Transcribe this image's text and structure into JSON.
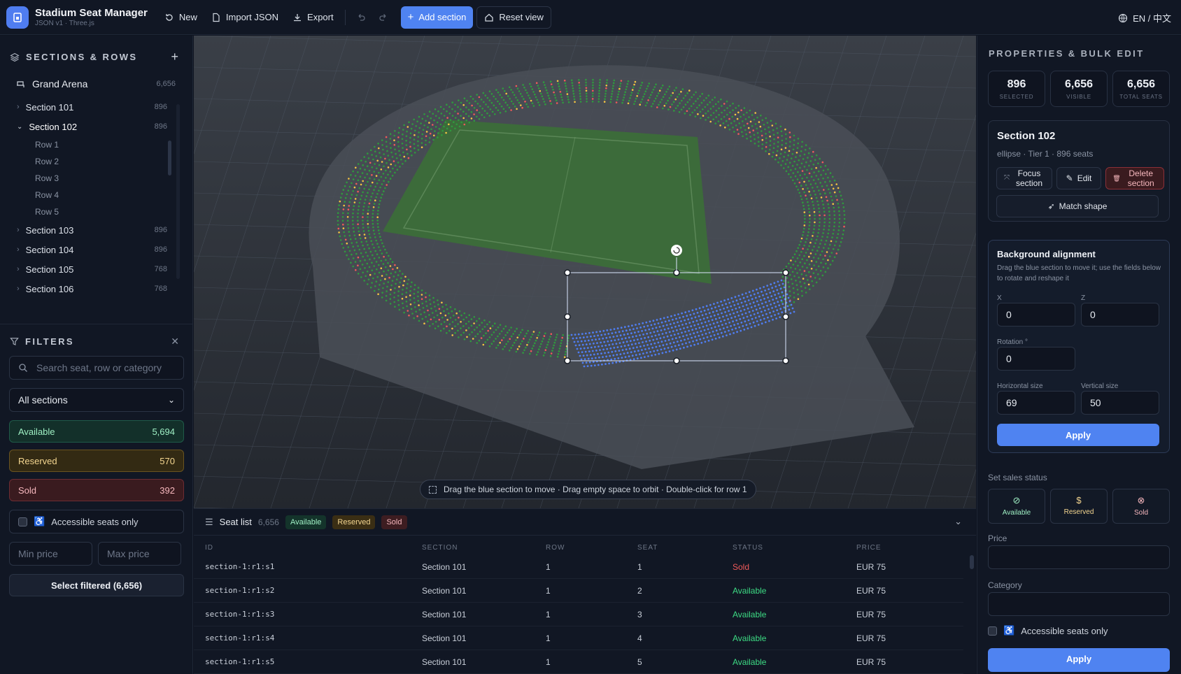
{
  "app": {
    "title": "Stadium Seat Manager",
    "subtitle": "JSON v1 · Three.js"
  },
  "toolbar": {
    "new": "New",
    "import": "Import JSON",
    "export": "Export",
    "add_section": "Add section",
    "reset_view": "Reset view",
    "lang": "EN / 中文"
  },
  "sections_panel": {
    "title": "SECTIONS & ROWS",
    "venue": {
      "name": "Grand Arena",
      "count": "6,656"
    },
    "sections": [
      {
        "name": "Section 101",
        "count": "896"
      },
      {
        "name": "Section 102",
        "count": "896"
      },
      {
        "name": "Section 103",
        "count": "896"
      },
      {
        "name": "Section 104",
        "count": "896"
      },
      {
        "name": "Section 105",
        "count": "768"
      },
      {
        "name": "Section 106",
        "count": "768"
      }
    ],
    "rows": [
      "Row 1",
      "Row 2",
      "Row 3",
      "Row 4",
      "Row 5"
    ]
  },
  "filters": {
    "title": "FILTERS",
    "search_placeholder": "Search seat, row or category",
    "section_select": "All sections",
    "available": {
      "label": "Available",
      "count": "5,694"
    },
    "reserved": {
      "label": "Reserved",
      "count": "570"
    },
    "sold": {
      "label": "Sold",
      "count": "392"
    },
    "accessible": "Accessible seats only",
    "min_price": "Min price",
    "max_price": "Max price",
    "select_filtered": "Select filtered (6,656)"
  },
  "viewport": {
    "hint": "Drag the blue section to move · Drag empty space to orbit · Double-click for row 1"
  },
  "seat_list": {
    "title": "Seat list",
    "count": "6,656",
    "badges": [
      "Available",
      "Reserved",
      "Sold"
    ],
    "columns": [
      "ID",
      "SECTION",
      "ROW",
      "SEAT",
      "STATUS",
      "PRICE"
    ],
    "rows": [
      {
        "id": "section-1:r1:s1",
        "section": "Section 101",
        "row": "1",
        "seat": "1",
        "status": "Sold",
        "price": "EUR 75"
      },
      {
        "id": "section-1:r1:s2",
        "section": "Section 101",
        "row": "1",
        "seat": "2",
        "status": "Available",
        "price": "EUR 75"
      },
      {
        "id": "section-1:r1:s3",
        "section": "Section 101",
        "row": "1",
        "seat": "3",
        "status": "Available",
        "price": "EUR 75"
      },
      {
        "id": "section-1:r1:s4",
        "section": "Section 101",
        "row": "1",
        "seat": "4",
        "status": "Available",
        "price": "EUR 75"
      },
      {
        "id": "section-1:r1:s5",
        "section": "Section 101",
        "row": "1",
        "seat": "5",
        "status": "Available",
        "price": "EUR 75"
      }
    ]
  },
  "properties": {
    "title": "PROPERTIES & BULK EDIT",
    "kpis": [
      {
        "value": "896",
        "label": "SELECTED"
      },
      {
        "value": "6,656",
        "label": "VISIBLE"
      },
      {
        "value": "6,656",
        "label": "TOTAL SEATS"
      }
    ],
    "section": {
      "name": "Section 102",
      "meta": "ellipse · Tier 1 · 896 seats"
    },
    "focus": "Focus section",
    "edit": "Edit",
    "delete": "Delete section",
    "match_shape": "Match shape",
    "alignment": {
      "title": "Background alignment",
      "desc": "Drag the blue section to move it; use the fields below to rotate and reshape it",
      "x_label": "X",
      "x": "0",
      "z_label": "Z",
      "z": "0",
      "rotation_label": "Rotation °",
      "rotation": "0",
      "h_label": "Horizontal size",
      "h": "69",
      "v_label": "Vertical size",
      "v": "50",
      "apply": "Apply"
    },
    "sales_status": "Set sales status",
    "status_buttons": [
      "Available",
      "Reserved",
      "Sold"
    ],
    "price_label": "Price",
    "category_label": "Category",
    "accessible": "Accessible seats only",
    "apply": "Apply"
  },
  "colors": {
    "accent": "#4f83f1",
    "available": "#3ddc84",
    "reserved": "#f5c542",
    "sold": "#ef5a5a",
    "seat_green": "#2f9a3e",
    "selected_blue": "#4f7df0"
  }
}
